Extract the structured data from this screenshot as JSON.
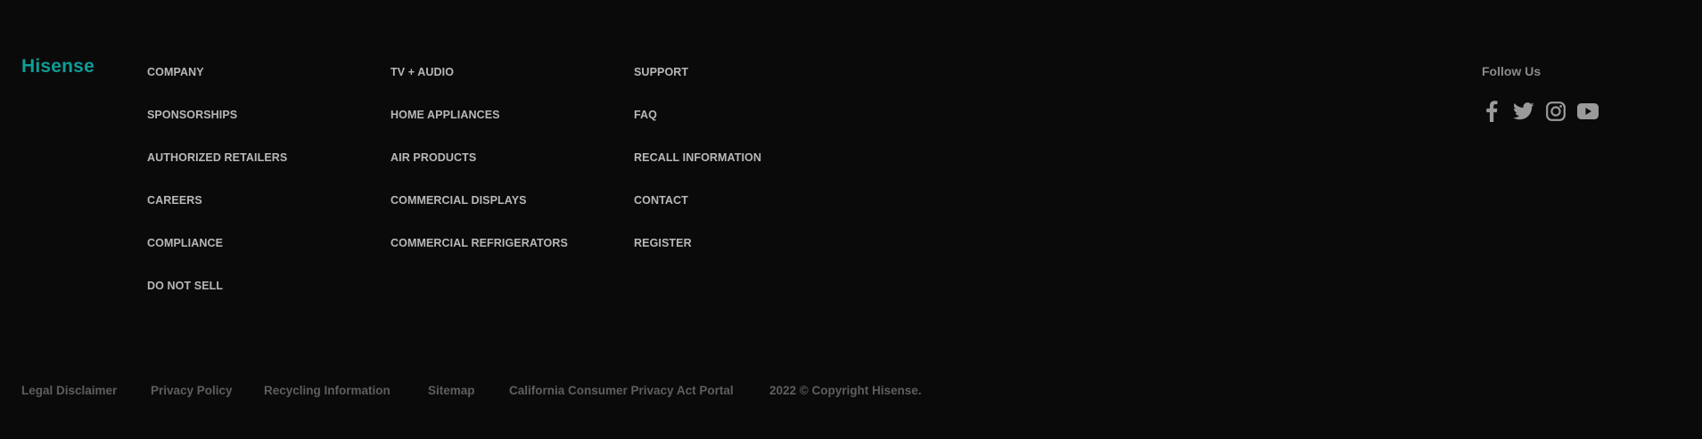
{
  "logo": {
    "text": "Hisense"
  },
  "columns": {
    "company": [
      "COMPANY",
      "SPONSORSHIPS",
      "AUTHORIZED RETAILERS",
      "CAREERS",
      "COMPLIANCE",
      "DO NOT SELL"
    ],
    "products": [
      "TV + AUDIO",
      "HOME APPLIANCES",
      "AIR PRODUCTS",
      "COMMERCIAL DISPLAYS",
      "COMMERCIAL REFRIGERATORS"
    ],
    "support": [
      "SUPPORT",
      "FAQ",
      "RECALL INFORMATION",
      "CONTACT",
      "REGISTER"
    ]
  },
  "follow": {
    "title": "Follow Us",
    "icons": [
      "facebook-icon",
      "twitter-icon",
      "instagram-icon",
      "youtube-icon"
    ]
  },
  "legal": {
    "links": [
      "Legal Disclaimer",
      "Privacy Policy",
      "Recycling Information",
      "Sitemap",
      "California Consumer Privacy Act Portal"
    ],
    "copyright": "2022 © Copyright Hisense."
  },
  "colors": {
    "background": "#0a0a0a",
    "brand": "#0f9c97",
    "link": "#b8b8b8",
    "muted": "#5e5e5e",
    "icon": "#9a9a9a"
  }
}
